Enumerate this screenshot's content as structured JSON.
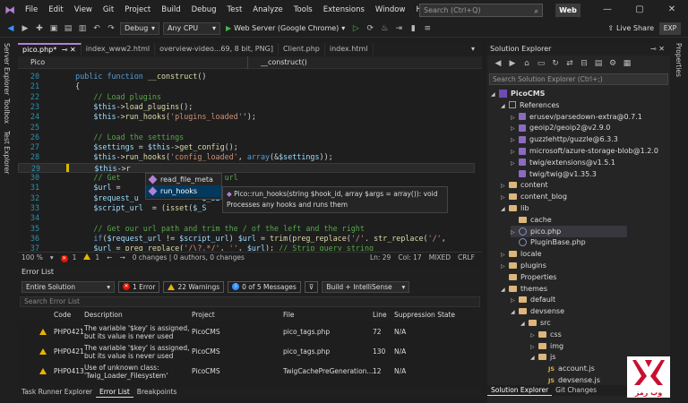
{
  "menubar": {
    "items": [
      "File",
      "Edit",
      "View",
      "Git",
      "Project",
      "Build",
      "Debug",
      "Test",
      "Analyze",
      "Tools",
      "Extensions",
      "Window",
      "Help"
    ],
    "search_placeholder": "Search (Ctrl+Q)",
    "badge": "Web"
  },
  "toolbar": {
    "config": "Debug",
    "platform": "Any CPU",
    "run_label": "Web Server (Google Chrome)",
    "liveshare": "Live Share",
    "exp": "EXP"
  },
  "side_tabs": {
    "left": [
      "Server Explorer",
      "Toolbox",
      "Test Explorer"
    ],
    "right": "Properties"
  },
  "editor": {
    "tabs": [
      "pico.php*",
      "index_www2.html",
      "overview-video...69, 8 bit, PNG]",
      "Client.php",
      "index.html"
    ],
    "nav_left": "Pico",
    "nav_right": "__construct()",
    "lines": [
      {
        "n": "20",
        "t": [
          [
            "pl",
            "    "
          ],
          [
            "kw",
            "public function "
          ],
          [
            "fn",
            "__construct"
          ],
          [
            "pl",
            "()"
          ]
        ]
      },
      {
        "n": "21",
        "t": [
          [
            "pl",
            "    {"
          ]
        ]
      },
      {
        "n": "22",
        "t": [
          [
            "pl",
            "        "
          ],
          [
            "cmt",
            "// Load plugins"
          ]
        ]
      },
      {
        "n": "23",
        "t": [
          [
            "pl",
            "        "
          ],
          [
            "var",
            "$this"
          ],
          [
            "pl",
            "->"
          ],
          [
            "fn",
            "load_plugins"
          ],
          [
            "pl",
            "();"
          ]
        ]
      },
      {
        "n": "24",
        "t": [
          [
            "pl",
            "        "
          ],
          [
            "var",
            "$this"
          ],
          [
            "pl",
            "->"
          ],
          [
            "fn",
            "run_hooks"
          ],
          [
            "pl",
            "("
          ],
          [
            "str",
            "'plugins_loaded'"
          ],
          [
            "pl",
            "');"
          ]
        ]
      },
      {
        "n": "25",
        "t": [
          [
            "pl",
            ""
          ]
        ]
      },
      {
        "n": "26",
        "t": [
          [
            "pl",
            "        "
          ],
          [
            "cmt",
            "// Load the settings"
          ]
        ]
      },
      {
        "n": "27",
        "t": [
          [
            "pl",
            "        "
          ],
          [
            "var",
            "$settings"
          ],
          [
            "pl",
            " = "
          ],
          [
            "var",
            "$this"
          ],
          [
            "pl",
            "->"
          ],
          [
            "fn",
            "get_config"
          ],
          [
            "pl",
            "();"
          ]
        ]
      },
      {
        "n": "28",
        "t": [
          [
            "pl",
            "        "
          ],
          [
            "var",
            "$this"
          ],
          [
            "pl",
            "->"
          ],
          [
            "fn",
            "run_hooks"
          ],
          [
            "pl",
            "("
          ],
          [
            "str",
            "'config_loaded'"
          ],
          [
            "pl",
            ", "
          ],
          [
            "kw",
            "array"
          ],
          [
            "pl",
            "(&"
          ],
          [
            "var",
            "$settings"
          ],
          [
            "pl",
            "));"
          ]
        ]
      },
      {
        "n": "29",
        "t": [
          [
            "pl",
            "        "
          ],
          [
            "var",
            "$this"
          ],
          [
            "pl",
            "->r"
          ]
        ]
      },
      {
        "n": "30",
        "t": [
          [
            "pl",
            "        "
          ],
          [
            "cmt",
            "// Get                 cript url"
          ]
        ]
      },
      {
        "n": "31",
        "t": [
          [
            "pl",
            "        "
          ],
          [
            "var",
            "$url"
          ],
          [
            "pl",
            " = "
          ]
        ]
      },
      {
        "n": "32",
        "t": [
          [
            "pl",
            "        "
          ],
          [
            "var",
            "$request_u"
          ],
          [
            "pl",
            "              "
          ],
          [
            "var",
            "$_SE"
          ]
        ]
      },
      {
        "n": "33",
        "t": [
          [
            "pl",
            "        "
          ],
          [
            "var",
            "$script_url"
          ],
          [
            "pl",
            "  = ("
          ],
          [
            "fn",
            "isset"
          ],
          [
            "pl",
            "("
          ],
          [
            "var",
            "$_S"
          ]
        ]
      },
      {
        "n": "34",
        "t": [
          [
            "pl",
            ""
          ]
        ]
      },
      {
        "n": "35",
        "t": [
          [
            "pl",
            "        "
          ],
          [
            "cmt",
            "// Get our url path and trim the / of the left and the right"
          ]
        ]
      },
      {
        "n": "36",
        "t": [
          [
            "pl",
            "        "
          ],
          [
            "kw",
            "if"
          ],
          [
            "pl",
            "("
          ],
          [
            "var",
            "$request_url"
          ],
          [
            "pl",
            " != "
          ],
          [
            "var",
            "$script_url"
          ],
          [
            "pl",
            ") "
          ],
          [
            "var",
            "$url"
          ],
          [
            "pl",
            " = "
          ],
          [
            "fn",
            "trim"
          ],
          [
            "pl",
            "("
          ],
          [
            "fn",
            "preg_replace"
          ],
          [
            "pl",
            "("
          ],
          [
            "str",
            "'/'"
          ],
          [
            "pl",
            ". "
          ],
          [
            "fn",
            "str_replace"
          ],
          [
            "pl",
            "("
          ],
          [
            "str",
            "'/'"
          ],
          [
            "pl",
            ", "
          ]
        ]
      },
      {
        "n": "37",
        "t": [
          [
            "pl",
            "        "
          ],
          [
            "var",
            "$url"
          ],
          [
            "pl",
            " = "
          ],
          [
            "fn",
            "preg_replace"
          ],
          [
            "pl",
            "("
          ],
          [
            "str",
            "'/\\?.*/'"
          ],
          [
            "pl",
            ", "
          ],
          [
            "str",
            "''"
          ],
          [
            "pl",
            ", "
          ],
          [
            "var",
            "$url"
          ],
          [
            "pl",
            "); "
          ],
          [
            "cmt",
            "// Strip query string"
          ]
        ]
      }
    ],
    "completion": [
      "read_file_meta",
      "run_hooks"
    ],
    "tooltip_sig": "Pico::run_hooks(string $hook_id, array $args = array()): void",
    "tooltip_desc": "Processes any hooks and runs them",
    "status": {
      "zoom": "100 %",
      "errors": "1",
      "warnings": "1",
      "changes": "0 changes | 0 authors, 0 changes",
      "ln": "Ln: 29",
      "col": "Col: 17",
      "mode": "MIXED",
      "eol": "CRLF"
    }
  },
  "error_list": {
    "title": "Error List",
    "scope": "Entire Solution",
    "errors": "1 Error",
    "warnings": "22 Warnings",
    "messages": "0 of 5 Messages",
    "build_filter": "Build + IntelliSense",
    "search_placeholder": "Search Error List",
    "columns": [
      "Code",
      "Description",
      "Project",
      "File",
      "Line",
      "Suppression State"
    ],
    "rows": [
      {
        "code": "PHP0421",
        "desc1": "The variable '$key' is assigned,",
        "desc2": "but its value is never used",
        "project": "PicoCMS",
        "file": "pico_tags.php",
        "line": "72",
        "state": "N/A"
      },
      {
        "code": "PHP0421",
        "desc1": "The variable '$key' is assigned,",
        "desc2": "but its value is never used",
        "project": "PicoCMS",
        "file": "pico_tags.php",
        "line": "130",
        "state": "N/A"
      },
      {
        "code": "PHP0413",
        "desc1": "Use of unknown class:",
        "desc2": "'Twig_Loader_Filesystem'",
        "project": "PicoCMS",
        "file": "TwigCachePreGeneration....",
        "line": "12",
        "state": "N/A"
      }
    ],
    "bottom_tabs": [
      "Task Runner Explorer",
      "Error List",
      "Breakpoints"
    ]
  },
  "solution_explorer": {
    "title": "Solution Explorer",
    "search_placeholder": "Search Solution Explorer (Ctrl+;)",
    "tree": [
      {
        "label": "PicoCMS",
        "lvl": 0,
        "tw": "◢",
        "ic": "sol"
      },
      {
        "label": "References",
        "lvl": 1,
        "tw": "◢",
        "ic": "ref"
      },
      {
        "label": "erusev/parsedown-extra@0.7.1",
        "lvl": 2,
        "tw": "▷",
        "ic": "pkg"
      },
      {
        "label": "geoip2/geoip2@v2.9.0",
        "lvl": 2,
        "tw": "▷",
        "ic": "pkg"
      },
      {
        "label": "guzzlehttp/guzzle@6.3.3",
        "lvl": 2,
        "tw": "▷",
        "ic": "pkg"
      },
      {
        "label": "microsoft/azure-storage-blob@1.2.0",
        "lvl": 2,
        "tw": "▷",
        "ic": "pkg"
      },
      {
        "label": "twig/extensions@v1.5.1",
        "lvl": 2,
        "tw": "▷",
        "ic": "pkg"
      },
      {
        "label": "twig/twig@v1.35.3",
        "lvl": 2,
        "tw": "",
        "ic": "pkg"
      },
      {
        "label": "content",
        "lvl": 1,
        "tw": "▷",
        "ic": "fold"
      },
      {
        "label": "content_blog",
        "lvl": 1,
        "tw": "▷",
        "ic": "fold"
      },
      {
        "label": "lib",
        "lvl": 1,
        "tw": "◢",
        "ic": "fold"
      },
      {
        "label": "cache",
        "lvl": 2,
        "tw": "",
        "ic": "fold"
      },
      {
        "label": "pico.php",
        "lvl": 2,
        "tw": "▷",
        "ic": "php"
      },
      {
        "label": "PluginBase.php",
        "lvl": 2,
        "tw": "",
        "ic": "php"
      },
      {
        "label": "locale",
        "lvl": 1,
        "tw": "▷",
        "ic": "fold"
      },
      {
        "label": "plugins",
        "lvl": 1,
        "tw": "▷",
        "ic": "fold"
      },
      {
        "label": "Properties",
        "lvl": 1,
        "tw": "",
        "ic": "fold"
      },
      {
        "label": "themes",
        "lvl": 1,
        "tw": "◢",
        "ic": "fold"
      },
      {
        "label": "default",
        "lvl": 2,
        "tw": "▷",
        "ic": "fold"
      },
      {
        "label": "devsense",
        "lvl": 2,
        "tw": "◢",
        "ic": "fold"
      },
      {
        "label": "src",
        "lvl": 3,
        "tw": "◢",
        "ic": "fold"
      },
      {
        "label": "css",
        "lvl": 4,
        "tw": "▷",
        "ic": "fold"
      },
      {
        "label": "img",
        "lvl": 4,
        "tw": "▷",
        "ic": "fold"
      },
      {
        "label": "js",
        "lvl": 4,
        "tw": "◢",
        "ic": "fold"
      },
      {
        "label": "account.js",
        "lvl": 5,
        "tw": "",
        "ic": "js"
      },
      {
        "label": "devsense.js",
        "lvl": 5,
        "tw": "",
        "ic": "js"
      }
    ],
    "bottom_tabs": [
      "Solution Explorer",
      "Git Changes"
    ]
  },
  "watermark_text": "وب رمز"
}
